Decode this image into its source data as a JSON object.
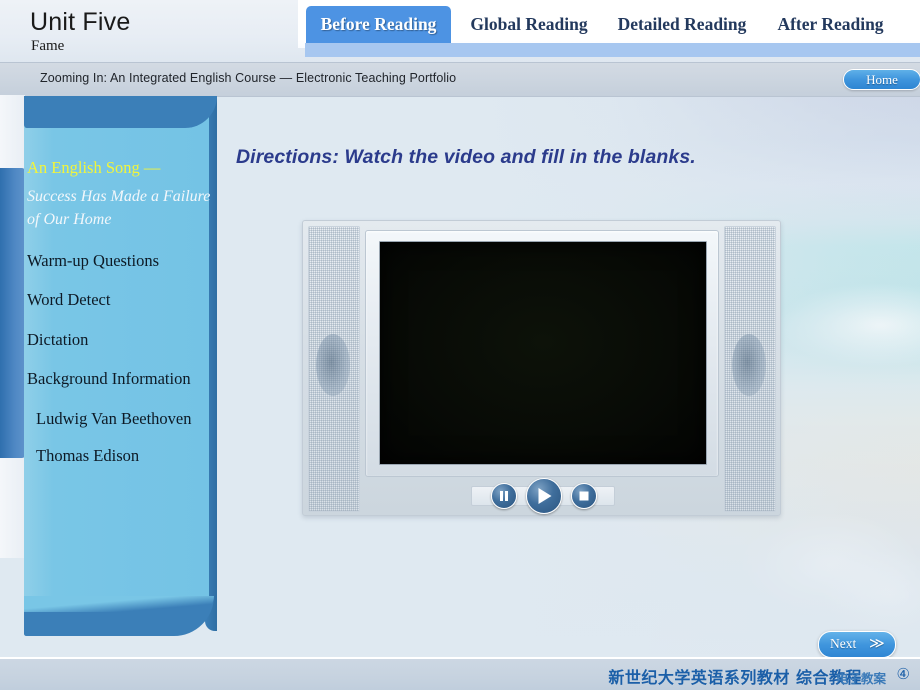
{
  "header": {
    "unit_title": "Unit Five",
    "unit_subtitle": "Fame",
    "tabs": [
      {
        "label": "Before Reading",
        "active": true
      },
      {
        "label": "Global Reading",
        "active": false
      },
      {
        "label": "Detailed Reading",
        "active": false
      },
      {
        "label": "After Reading",
        "active": false
      }
    ],
    "course_bar": "Zooming In: An Integrated English Course — Electronic Teaching Portfolio",
    "home_label": "Home"
  },
  "sidebar": {
    "items": [
      {
        "label": "An English Song —",
        "style": "song-head"
      },
      {
        "label": "Success Has Made a Failure of Our Home",
        "style": "song-sub"
      },
      {
        "label": "Warm-up Questions",
        "style": "plain"
      },
      {
        "label": "Word Detect",
        "style": "plain"
      },
      {
        "label": "Dictation",
        "style": "plain"
      },
      {
        "label": "Background Information",
        "style": "plain"
      },
      {
        "label": "Ludwig Van Beethoven",
        "style": "indent"
      },
      {
        "label": "Thomas Edison",
        "style": "indent"
      }
    ]
  },
  "main": {
    "directions": "Directions: Watch the video and fill in the blanks.",
    "player": {
      "pause_icon": "pause-icon",
      "play_icon": "play-icon",
      "stop_icon": "stop-icon",
      "screen_state": "blank"
    }
  },
  "navigation": {
    "next_label": "Next",
    "next_arrow": "≫"
  },
  "footer": {
    "series_title": "新世纪大学英语系列教材 综合教程",
    "subtitle": "电子教案",
    "volume": "④"
  },
  "colors": {
    "accent_blue": "#4d93e3",
    "sidebar_blue": "#74c3e5",
    "sidebar_dark": "#3b7fb8",
    "highlight_yellow": "#f2f53a",
    "directions_navy": "#2b3b8c",
    "footer_blue": "#1b5fa8"
  }
}
